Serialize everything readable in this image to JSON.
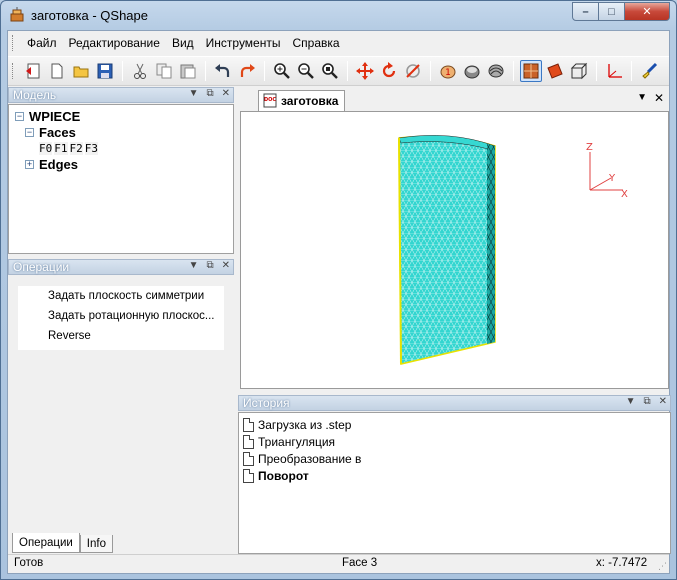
{
  "window": {
    "title": "заготовка - QShape",
    "controls": {
      "minimize": "–",
      "maximize": "□",
      "close": "✕"
    }
  },
  "menubar": {
    "items": [
      "Файл",
      "Редактирование",
      "Вид",
      "Инструменты",
      "Справка"
    ]
  },
  "toolbar": {
    "icons": [
      "open-icon",
      "new-icon",
      "open-folder-icon",
      "save-icon",
      "cut-icon",
      "copy-icon",
      "paste-icon",
      "undo-icon",
      "redo-icon",
      "zoom-in-icon",
      "zoom-out-icon",
      "zoom-fit-icon",
      "pan-icon",
      "rotate-icon",
      "rotate-axis-icon",
      "shading-icon",
      "wireframe-icon",
      "mesh-icon",
      "solid-view-icon",
      "surface-view-icon",
      "box-view-icon",
      "axes-icon",
      "brush-icon"
    ],
    "active": "solid-view-icon"
  },
  "model_panel": {
    "title": "Модель",
    "root": "WPIECE",
    "faces_label": "Faces",
    "faces": [
      "F0",
      "F1",
      "F2",
      "F3"
    ],
    "edges_label": "Edges"
  },
  "operations_panel": {
    "title": "Операции",
    "items": [
      "Задать плоскость симметрии",
      "Задать ротационную плоскос...",
      "Reverse"
    ],
    "tabs": [
      "Операции",
      "Info"
    ],
    "active_tab": "Операции"
  },
  "document": {
    "tab_label": "заготовка",
    "axes": {
      "z": "Z",
      "y": "Y",
      "x": "X"
    },
    "mesh_color": "#33d6d0",
    "highlight_color": "#e8e200"
  },
  "history_panel": {
    "title": "История",
    "items": [
      {
        "label": "Загрузка из .step",
        "bold": false
      },
      {
        "label": "Триангуляция",
        "bold": false
      },
      {
        "label": "Преобразование в",
        "bold": false
      },
      {
        "label": "Поворот",
        "bold": true
      }
    ]
  },
  "statusbar": {
    "status": "Готов",
    "selection": "Face 3",
    "coordinate": "x: -7.7472"
  }
}
